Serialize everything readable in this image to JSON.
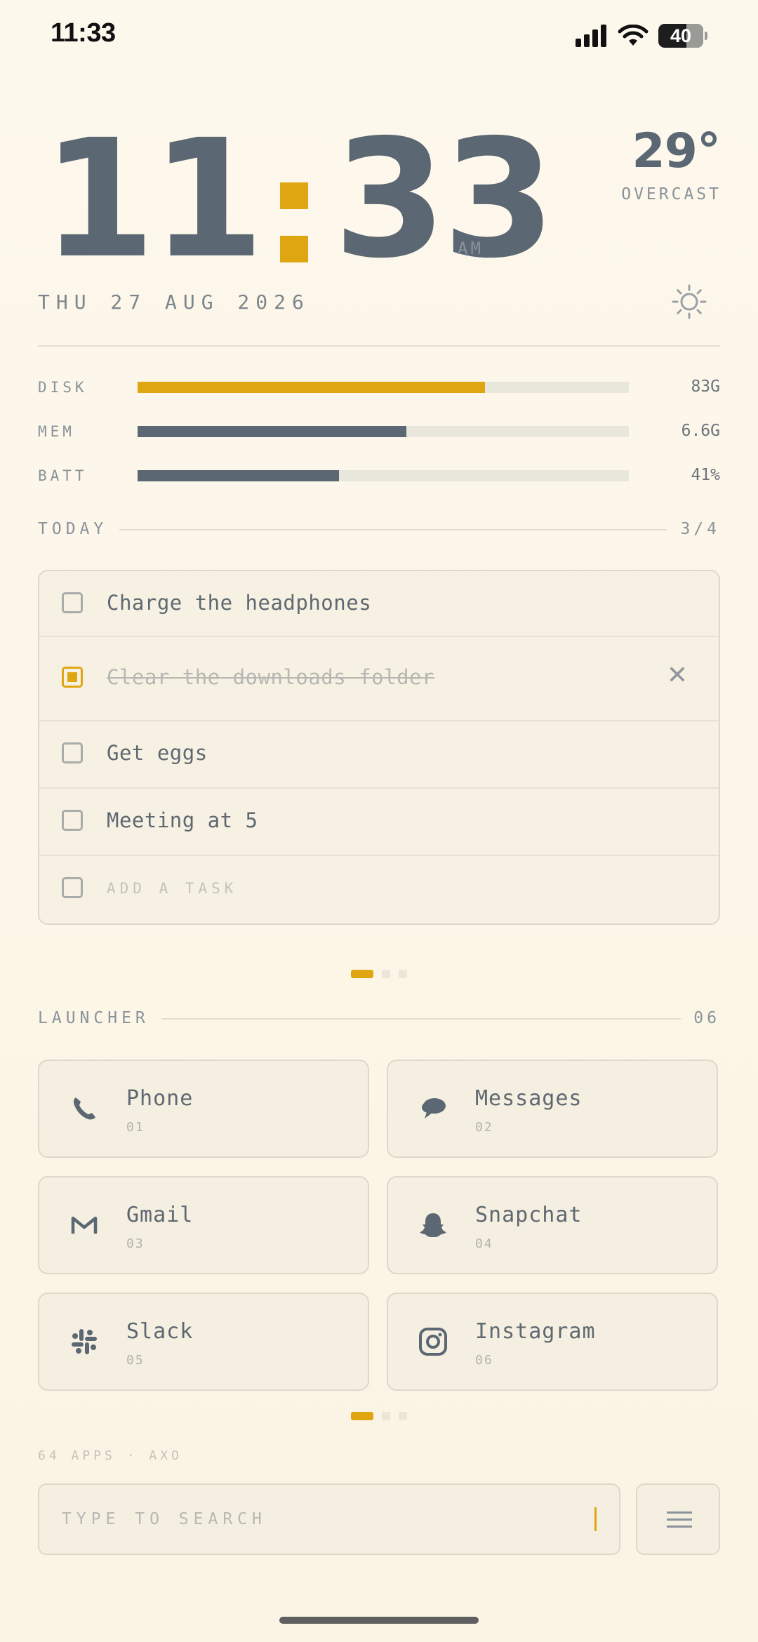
{
  "status_bar": {
    "time": "11:33",
    "battery": "40"
  },
  "clock": {
    "hours": "11",
    "minutes": "33",
    "ampm": "AM"
  },
  "weather": {
    "temp": "29°",
    "condition": "OVERCAST",
    "icon": "sun-icon"
  },
  "date": "THU 27 AUG 2026",
  "stats": [
    {
      "label": "DISK",
      "value": "83G",
      "fill_fraction": 0.707,
      "color": "#e0a612"
    },
    {
      "label": "MEM",
      "value": "6.6G",
      "fill_fraction": 0.547,
      "color": "#5b6772"
    },
    {
      "label": "BATT",
      "value": "41%",
      "fill_fraction": 0.41,
      "color": "#5b6772"
    }
  ],
  "today": {
    "label": "TODAY",
    "count": "3/4",
    "tasks": [
      {
        "text": "Charge the headphones",
        "done": false
      },
      {
        "text": "Clear the downloads folder",
        "done": true
      },
      {
        "text": "Get eggs",
        "done": false
      },
      {
        "text": "Meeting at 5",
        "done": false
      }
    ],
    "add_placeholder": "ADD A TASK"
  },
  "launcher": {
    "label": "LAUNCHER",
    "count": "06",
    "apps": [
      {
        "name": "Phone",
        "num": "01",
        "icon": "phone-icon"
      },
      {
        "name": "Messages",
        "num": "02",
        "icon": "messages-icon"
      },
      {
        "name": "Gmail",
        "num": "03",
        "icon": "gmail-icon"
      },
      {
        "name": "Snapchat",
        "num": "04",
        "icon": "snapchat-icon"
      },
      {
        "name": "Slack",
        "num": "05",
        "icon": "slack-icon"
      },
      {
        "name": "Instagram",
        "num": "06",
        "icon": "instagram-icon"
      }
    ]
  },
  "footer": {
    "note": "64 APPS · AXO"
  },
  "search": {
    "placeholder": "TYPE TO SEARCH"
  },
  "colors": {
    "accent": "#e0a612",
    "ink": "#5b6772",
    "background": "#fcf6e8"
  }
}
